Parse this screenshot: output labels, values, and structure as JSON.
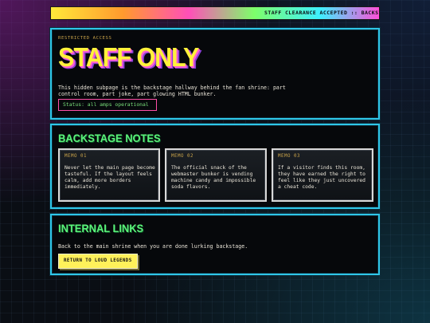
{
  "ticker": {
    "text": "STAFF CLEARANCE ACCEPTED :: BACKSTAGE ACCESS GRANTED"
  },
  "hero": {
    "eyebrow": "RESTRICTED ACCESS",
    "title": "STAFF ONLY",
    "description": "This hidden subpage is the backstage hallway behind the fan shrine: part control room, part joke, part glowing HTML bunker.",
    "status": "Status: all amps operational"
  },
  "notes": {
    "title": "BACKSTAGE NOTES",
    "memos": [
      {
        "label": "MEMO 01",
        "body": "Never let the main page become tasteful. If the layout feels calm, add more borders immediately."
      },
      {
        "label": "MEMO 02",
        "body": "The official snack of the webmaster bunker is vending machine candy and impossible soda flavors."
      },
      {
        "label": "MEMO 03",
        "body": "If a visitor finds this room, they have earned the right to feel like they just uncovered a cheat code."
      }
    ]
  },
  "links": {
    "title": "INTERNAL LINKS",
    "description": "Back to the main shrine when you are done lurking backstage.",
    "button_label": "RETURN TO LOUD LEGENDS"
  },
  "colors": {
    "panel_border": "#2fc6e8",
    "title_yellow": "#fff23a",
    "section_green": "#5cf27a",
    "status_border": "#ff4fa8",
    "button_bg": "#fff15a"
  }
}
